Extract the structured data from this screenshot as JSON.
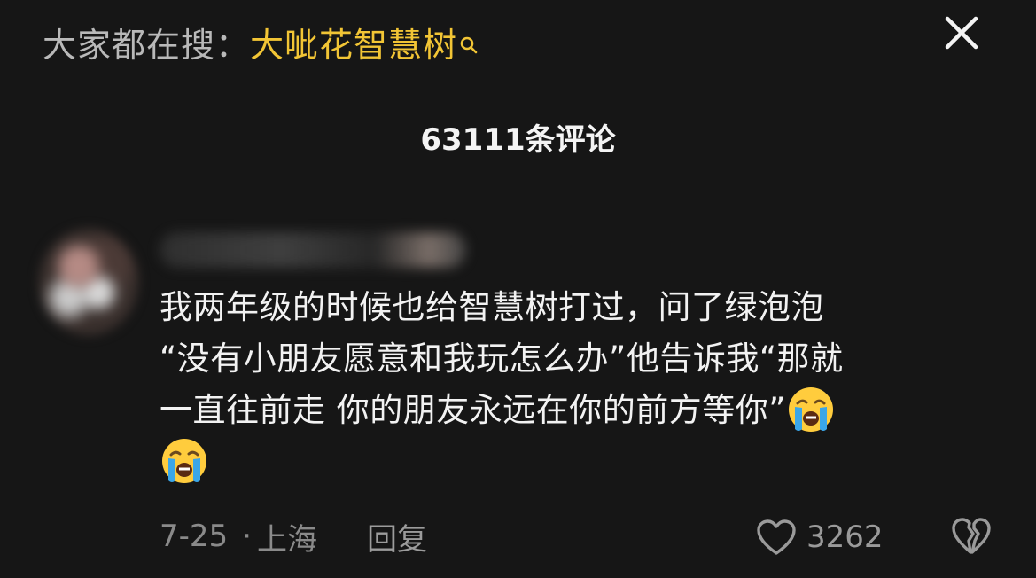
{
  "header": {
    "search_prefix": "大家都在搜：",
    "search_term": "大呲花智慧树",
    "search_icon": "search-icon",
    "close_icon": "close-icon"
  },
  "comments_panel": {
    "count_text": "63111条评论"
  },
  "comment": {
    "lines": [
      "我两年级的时候也给智慧树打过，问了绿泡泡",
      "“没有小朋友愿意和我玩怎么办”他告诉我“那就",
      "一直往前走 你的朋友永远在你的前方等你”"
    ],
    "emoji": "loudly-crying-face-emoji",
    "date": "7-25",
    "dot": "·",
    "location": "上海",
    "reply_label": "回复",
    "like_count": "3262",
    "like_icon": "heart-outline-icon",
    "dislike_icon": "broken-heart-icon"
  },
  "colors": {
    "background": "#161616",
    "search_term": "#f2c535",
    "text_primary": "#f2f2f2",
    "text_secondary": "#8a8a8a"
  }
}
